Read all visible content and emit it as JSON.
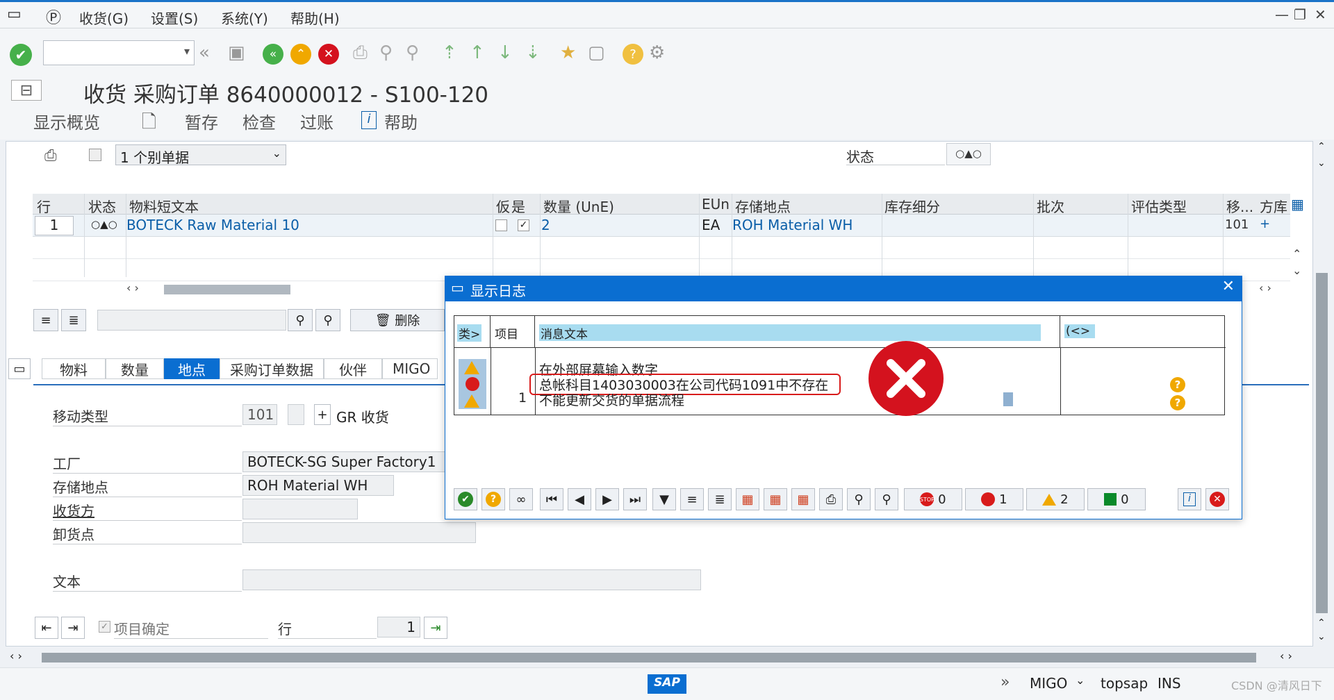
{
  "menu": {
    "items": [
      "收货(G)",
      "设置(S)",
      "系统(Y)",
      "帮助(H)"
    ]
  },
  "title": "收货 采购订单 8640000012 - S100-120",
  "appbar": {
    "overview": "显示概览",
    "hold": "暂存",
    "check": "检查",
    "post": "过账",
    "help": "帮助"
  },
  "header": {
    "doc_select": "1 个别单据",
    "status_label": "状态"
  },
  "table": {
    "headers": [
      "行",
      "状态",
      "物料短文本",
      "仮",
      "是",
      "数量 (UnE)",
      "EUn",
      "存储地点",
      "库存细分",
      "批次",
      "评估类型",
      "移...",
      "方",
      "库"
    ],
    "row": {
      "line": "1",
      "material": "BOTECK Raw Material 10",
      "qty": "2",
      "unit": "EA",
      "sloc": "ROH Material WH",
      "mvt": "101",
      "plus": "+"
    }
  },
  "toolbar2": {
    "delete": "删除"
  },
  "tabs": [
    "物料",
    "数量",
    "地点",
    "采购订单数据",
    "伙伴",
    "MIGO"
  ],
  "form": {
    "mvt_label": "移动类型",
    "mvt_value": "101",
    "mvt_plus": "+",
    "mvt_text": "GR 收货",
    "plant_label": "工厂",
    "plant_value": "BOTECK-SG Super Factory1",
    "sloc_label": "存储地点",
    "sloc_value": "ROH Material WH",
    "recv_label": "收货方",
    "unload_label": "卸货点",
    "text_label": "文本",
    "item_ok": "项目确定",
    "row_label": "行",
    "row_value": "1"
  },
  "dialog": {
    "title": "显示日志",
    "col_type": "类>",
    "col_item": "项目",
    "col_msg": "消息文本",
    "col_k": "(<>",
    "messages": [
      {
        "item": "",
        "text": "在外部屏幕输入数字"
      },
      {
        "item": "",
        "text": "总帐科目1403030003在公司代码1091中不存在"
      },
      {
        "item": "1",
        "text": "不能更新交货的单据流程"
      }
    ],
    "counts": {
      "stop": "0",
      "error": "1",
      "warning": "2",
      "success": "0"
    }
  },
  "status": {
    "tcode": "MIGO",
    "server": "topsap",
    "mode": "INS",
    "watermark": "CSDN @清风日下"
  },
  "colors": {
    "accent": "#0a6ed1",
    "error": "#d81b1b",
    "warning": "#f0a800",
    "link": "#0a5ea8"
  }
}
